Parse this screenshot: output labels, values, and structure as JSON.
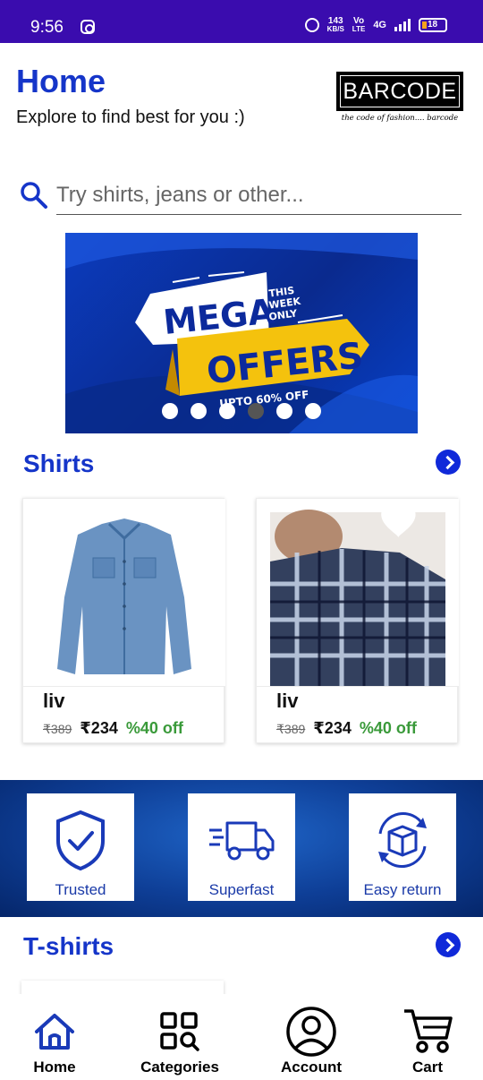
{
  "status_bar": {
    "time": "9:56",
    "net_speed_value": "143",
    "net_speed_unit": "KB/S",
    "volte_top": "Vo",
    "volte_bottom": "LTE",
    "network": "4G",
    "battery": "18"
  },
  "header": {
    "title": "Home",
    "subtitle": "Explore to find best for you :)",
    "logo_text": "BARCODE",
    "logo_tagline": "the code of fashion.... barcode"
  },
  "search": {
    "placeholder": "Try shirts, jeans or other..."
  },
  "banner": {
    "line1": "MEGA",
    "line2": "OFFERS",
    "side_text": [
      "THIS",
      "WEEK",
      "ONLY"
    ],
    "offer_text": "UPTO 60% OFF",
    "slide_count": 6,
    "active_slide": 4
  },
  "shirts_section": {
    "title": "Shirts",
    "products": [
      {
        "brand": "liv",
        "mrp": "₹389",
        "price": "₹234",
        "discount": "%40 off",
        "image": "denim-shirt",
        "favorite": false
      },
      {
        "brand": "liv",
        "mrp": "₹389",
        "price": "₹234",
        "discount": "%40 off",
        "image": "plaid-shirt",
        "favorite": true
      }
    ]
  },
  "features": [
    {
      "label": "Trusted",
      "icon": "shield-check-icon"
    },
    {
      "label": "Superfast",
      "icon": "delivery-truck-icon"
    },
    {
      "label": "Easy return",
      "icon": "return-box-icon"
    }
  ],
  "tshirts_section": {
    "title": "T-shirts"
  },
  "bottom_nav": [
    {
      "label": "Home",
      "icon": "home-icon",
      "active": true
    },
    {
      "label": "Categories",
      "icon": "categories-icon",
      "active": false
    },
    {
      "label": "Account",
      "icon": "account-icon",
      "active": false
    },
    {
      "label": "Cart",
      "icon": "cart-icon",
      "active": false
    }
  ],
  "colors": {
    "status_bar": "#3a0cae",
    "accent": "#1535c9",
    "discount": "#3a9a3a"
  }
}
